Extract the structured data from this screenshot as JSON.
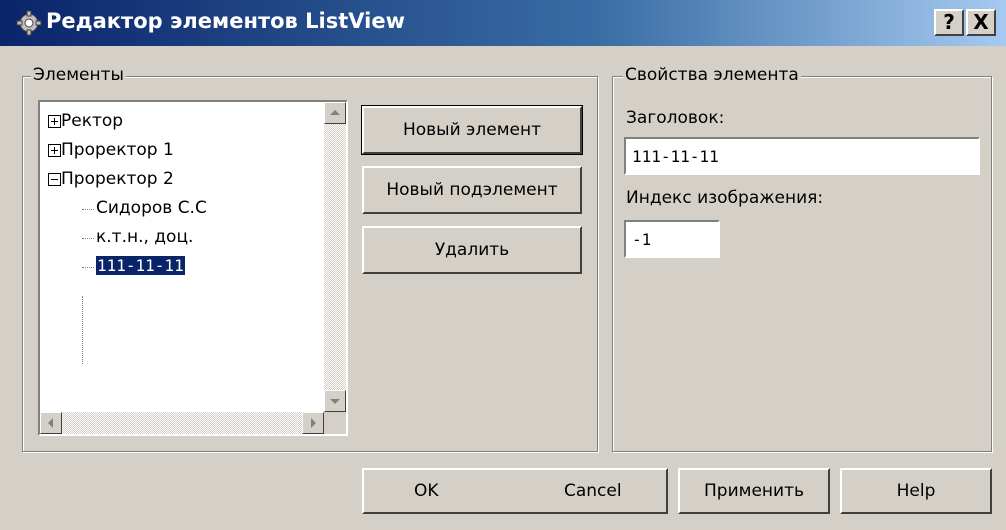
{
  "window": {
    "title": "Редактор элементов ListView",
    "help_label": "?",
    "close_label": "X"
  },
  "members_group": {
    "legend": "Элементы",
    "tree": [
      {
        "label": "Ректор",
        "expander": "plus"
      },
      {
        "label": "Проректор 1",
        "expander": "plus"
      },
      {
        "label": "Проректор 2",
        "expander": "minus"
      },
      {
        "label": "Сидоров С.С"
      },
      {
        "label": "к.т.н., доц."
      },
      {
        "label": "111-11-11",
        "selected": true
      }
    ]
  },
  "buttons": {
    "new_item": "Новый элемент",
    "new_subitem": "Новый подэлемент",
    "delete": "Удалить",
    "ok": "OK",
    "cancel": "Cancel",
    "apply": "Применить",
    "help": "Help"
  },
  "properties_group": {
    "legend": "Свойства элемента",
    "caption_label": "Заголовок:",
    "caption_value": "111-11-11",
    "image_index_label": "Индекс изображения:",
    "image_index_value": "-1"
  }
}
